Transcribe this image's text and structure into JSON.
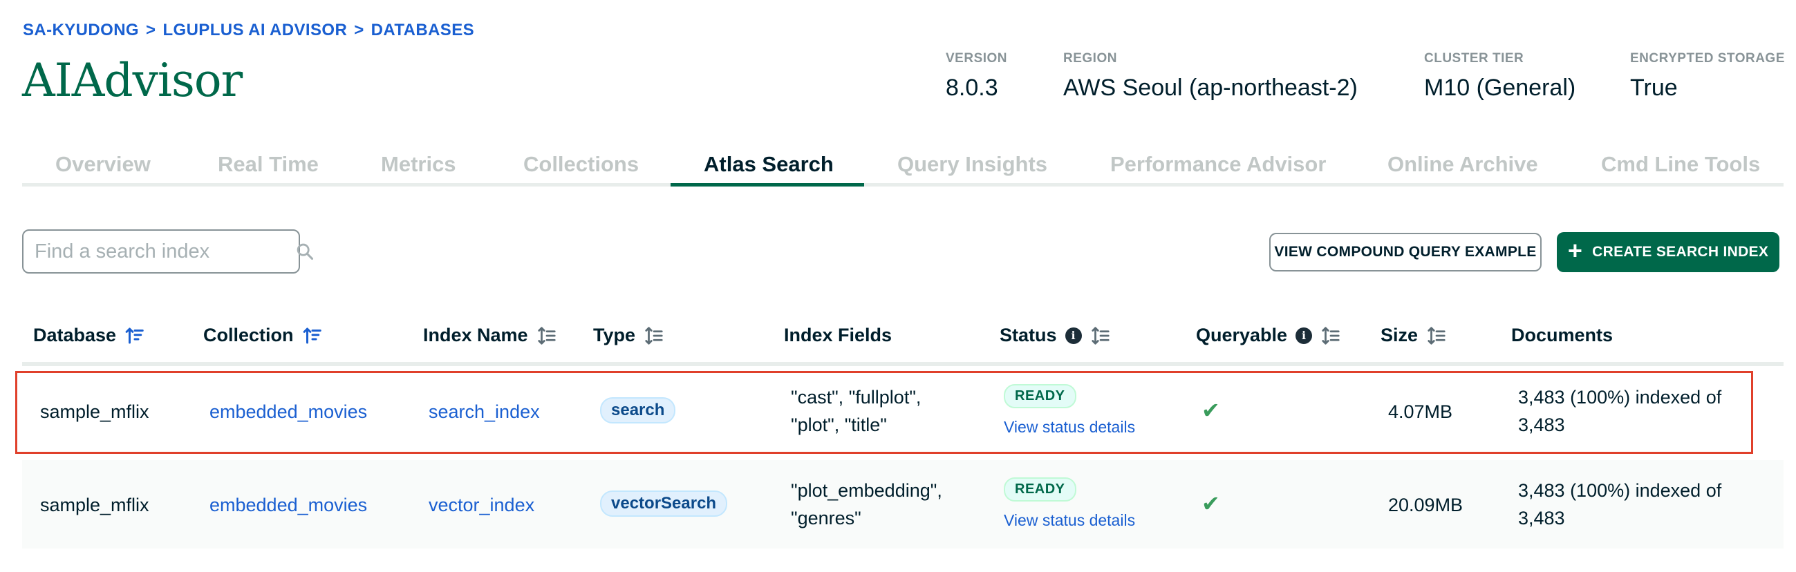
{
  "breadcrumb": [
    "SA-KYUDONG",
    "LGUPLUS AI ADVISOR",
    "DATABASES"
  ],
  "breadcrumb_separator": ">",
  "page_title": "AIAdvisor",
  "meta": {
    "version": {
      "label": "VERSION",
      "value": "8.0.3"
    },
    "region": {
      "label": "REGION",
      "value": "AWS Seoul (ap-northeast-2)"
    },
    "cluster_tier": {
      "label": "CLUSTER TIER",
      "value": "M10 (General)"
    },
    "encrypted_storage": {
      "label": "ENCRYPTED STORAGE",
      "value": "True"
    }
  },
  "tabs": [
    {
      "label": "Overview",
      "active": false
    },
    {
      "label": "Real Time",
      "active": false
    },
    {
      "label": "Metrics",
      "active": false
    },
    {
      "label": "Collections",
      "active": false
    },
    {
      "label": "Atlas Search",
      "active": true
    },
    {
      "label": "Query Insights",
      "active": false
    },
    {
      "label": "Performance Advisor",
      "active": false
    },
    {
      "label": "Online Archive",
      "active": false
    },
    {
      "label": "Cmd Line Tools",
      "active": false
    }
  ],
  "search": {
    "placeholder": "Find a search index",
    "value": ""
  },
  "buttons": {
    "view_compound": "VIEW COMPOUND QUERY EXAMPLE",
    "create_index": "CREATE SEARCH INDEX"
  },
  "table": {
    "columns": [
      "Database",
      "Collection",
      "Index Name",
      "Type",
      "Index Fields",
      "Status",
      "Queryable",
      "Size",
      "Documents"
    ],
    "rows": [
      {
        "database": "sample_mflix",
        "collection": "embedded_movies",
        "index_name": "search_index",
        "type": "search",
        "fields_line1": "\"cast\", \"fullplot\",",
        "fields_line2": "\"plot\", \"title\"",
        "status": "READY",
        "status_link": "View status details",
        "queryable": true,
        "size": "4.07MB",
        "docs_line1": "3,483 (100%) indexed of",
        "docs_line2": "3,483"
      },
      {
        "database": "sample_mflix",
        "collection": "embedded_movies",
        "index_name": "vector_index",
        "type": "vectorSearch",
        "fields_line1": "\"plot_embedding\",",
        "fields_line2": "\"genres\"",
        "status": "READY",
        "status_link": "View status details",
        "queryable": true,
        "size": "20.09MB",
        "docs_line1": "3,483 (100%) indexed of",
        "docs_line2": "3,483"
      }
    ]
  },
  "colors": {
    "accent": "#00684a",
    "link": "#1a5fd1",
    "highlight": "#e0402b"
  }
}
